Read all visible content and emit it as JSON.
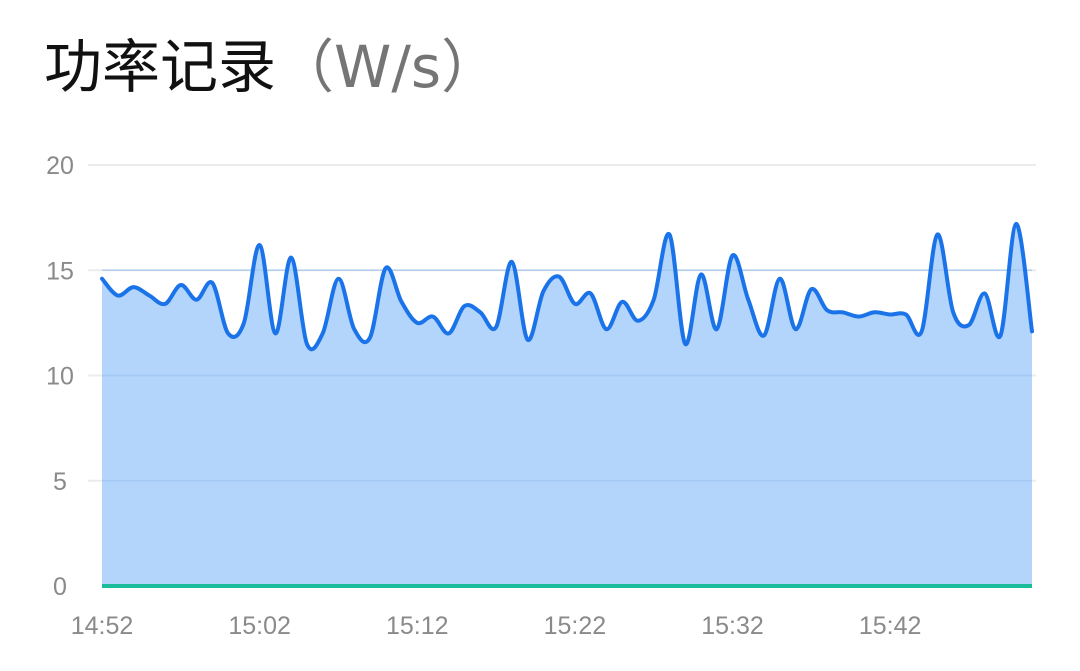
{
  "title": "功率记录",
  "title_unit": "（W/s）",
  "colors": {
    "line": "#1a73e8",
    "area": "#b3d4fb",
    "baseline": "#1abc9c",
    "grid": "#ececec",
    "tick": "#8a8a8a"
  },
  "chart_data": {
    "type": "area",
    "title": "功率记录（W/s）",
    "xlabel": "",
    "ylabel": "",
    "ylim": [
      0,
      20
    ],
    "yticks": [
      "0",
      "5",
      "10",
      "15",
      "20"
    ],
    "xticks": [
      "14:52",
      "15:02",
      "15:12",
      "15:22",
      "15:32",
      "15:42"
    ],
    "x_start": "14:52",
    "x_end": "15:51",
    "grid": true,
    "series": [
      {
        "x": [
          "14:52",
          "14:53",
          "14:54",
          "14:55",
          "14:56",
          "14:57",
          "14:58",
          "14:59",
          "15:00",
          "15:01",
          "15:02",
          "15:03",
          "15:04",
          "15:05",
          "15:06",
          "15:07",
          "15:08",
          "15:09",
          "15:10",
          "15:11",
          "15:12",
          "15:13",
          "15:14",
          "15:15",
          "15:16",
          "15:17",
          "15:18",
          "15:19",
          "15:20",
          "15:21",
          "15:22",
          "15:23",
          "15:24",
          "15:25",
          "15:26",
          "15:27",
          "15:28",
          "15:29",
          "15:30",
          "15:31",
          "15:32",
          "15:33",
          "15:34",
          "15:35",
          "15:36",
          "15:37",
          "15:38",
          "15:39",
          "15:40",
          "15:41",
          "15:42",
          "15:43",
          "15:44",
          "15:45",
          "15:46",
          "15:47",
          "15:48",
          "15:49",
          "15:50",
          "15:51"
        ],
        "values": [
          14.6,
          13.8,
          14.2,
          13.8,
          13.4,
          14.3,
          13.6,
          14.4,
          12.0,
          12.5,
          16.2,
          12.0,
          15.6,
          11.5,
          12.0,
          14.6,
          12.2,
          11.8,
          15.1,
          13.5,
          12.5,
          12.8,
          12.0,
          13.3,
          13.0,
          12.3,
          15.4,
          11.7,
          14.0,
          14.7,
          13.4,
          13.9,
          12.2,
          13.5,
          12.6,
          13.6,
          16.7,
          11.5,
          14.8,
          12.2,
          15.7,
          13.6,
          11.9,
          14.6,
          12.2,
          14.1,
          13.1,
          13.0,
          12.8,
          13.0,
          12.9,
          12.9,
          12.1,
          16.7,
          13.0,
          12.4,
          13.9,
          11.9,
          17.2,
          12.1
        ]
      }
    ]
  }
}
